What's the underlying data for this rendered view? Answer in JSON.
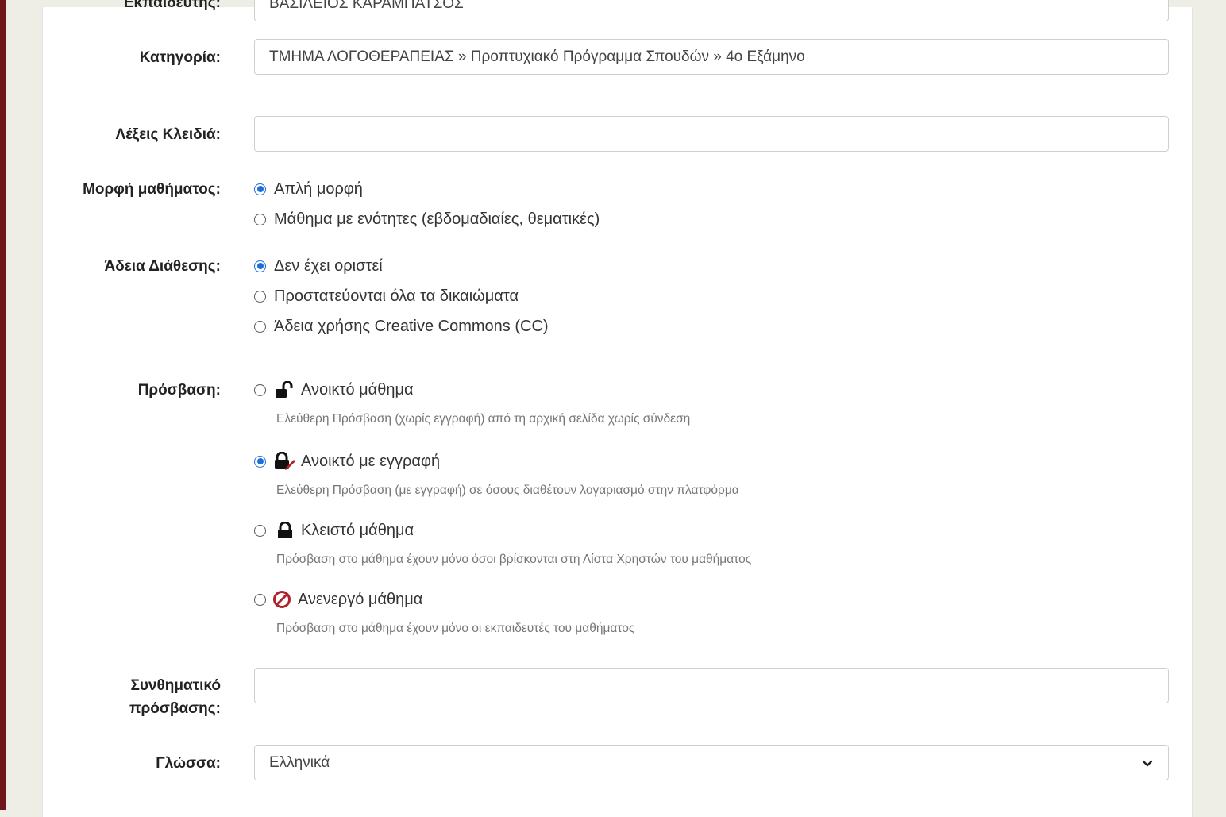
{
  "form": {
    "top_label": "Εκπαιδευτής:",
    "top_value": "ΒΑΣΙΛΕΙΟΣ ΚΑΡΑΜΠΑΤΣΟΣ",
    "category_label": "Κατηγορία:",
    "category_value": "ΤΜΗΜΑ ΛΟΓΟΘΕΡΑΠΕΙΑΣ » Προπτυχιακό Πρόγραμμα Σπουδών » 4ο Εξάμηνο",
    "keywords_label": "Λέξεις Κλειδιά:",
    "keywords_value": "",
    "format_label": "Μορφή μαθήματος:",
    "format_options": [
      {
        "label": "Απλή μορφή",
        "checked": true
      },
      {
        "label": "Μάθημα με ενότητες (εβδομαδιαίες, θεματικές)",
        "checked": false
      }
    ],
    "license_label": "Άδεια Διάθεσης:",
    "license_options": [
      {
        "label": "Δεν έχει οριστεί",
        "checked": true
      },
      {
        "label": "Προστατεύονται όλα τα δικαιώματα",
        "checked": false
      },
      {
        "label": "Άδεια χρήσης Creative Commons (CC)",
        "checked": false
      }
    ],
    "access_label": "Πρόσβαση:",
    "access_options": [
      {
        "label": "Ανοικτό μάθημα",
        "hint": "Ελεύθερη Πρόσβαση (χωρίς εγγραφή) από τη αρχική σελίδα χωρίς σύνδεση",
        "icon": "unlock-icon",
        "checked": false
      },
      {
        "label": "Ανοικτό με εγγραφή",
        "hint": "Ελεύθερη Πρόσβαση (με εγγραφή) σε όσους διαθέτουν λογαριασμό στην πλατφόρμα",
        "icon": "lock-edit-icon",
        "checked": true
      },
      {
        "label": "Κλειστό μάθημα",
        "hint": "Πρόσβαση στο μάθημα έχουν μόνο όσοι βρίσκονται στη Λίστα Χρηστών του μαθήματος",
        "icon": "lock-icon",
        "checked": false
      },
      {
        "label": "Ανενεργό μάθημα",
        "hint": "Πρόσβαση στο μάθημα έχουν μόνο οι εκπαιδευτές του μαθήματος",
        "icon": "ban-icon",
        "checked": false
      }
    ],
    "password_label_line1": "Συνθηματικό",
    "password_label_line2": "πρόσβασης:",
    "password_value": "",
    "language_label": "Γλώσσα:",
    "language_value": "Ελληνικά"
  },
  "colors": {
    "accent": "#1b6fd8",
    "ban": "#b0232a",
    "sidebar": "#6e1618"
  }
}
